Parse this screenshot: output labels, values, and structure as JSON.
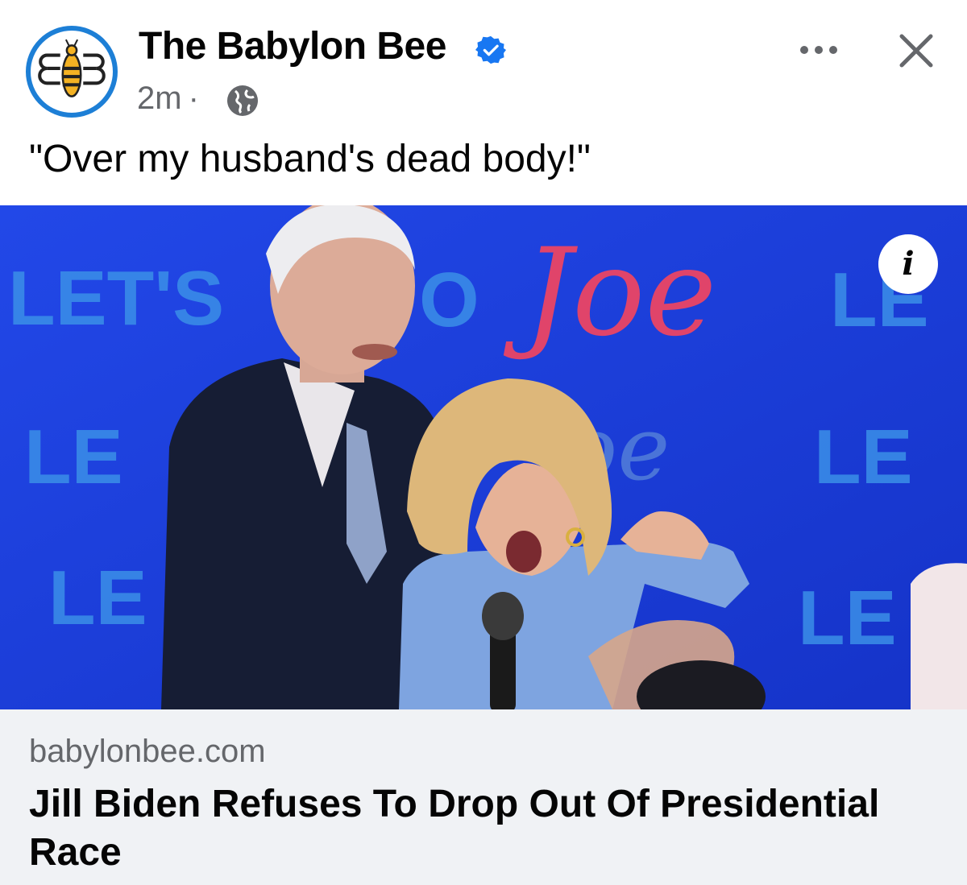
{
  "post": {
    "page_name": "The Babylon Bee",
    "timestamp": "2m",
    "separator": "·",
    "caption": "\"Over my husband's dead body!\""
  },
  "icons": {
    "avatar": "babylon-bee-logo",
    "verified": "verified-badge-icon",
    "privacy": "globe-icon",
    "more": "more-dots-icon",
    "close": "close-icon",
    "info": "info-icon"
  },
  "media": {
    "info_label": "i",
    "backdrop_text": [
      "LET'S",
      "O",
      "Joe",
      "LE",
      "LE",
      "oe",
      "LE",
      "LE",
      "LE"
    ]
  },
  "link_preview": {
    "domain": "babylonbee.com",
    "headline": "Jill Biden Refuses To Drop Out Of Presidential Race"
  },
  "colors": {
    "verified_blue": "#1877f2",
    "backdrop_blue": "#1a3ee0",
    "preview_bg": "#f0f2f5",
    "secondary_text": "#65676b"
  }
}
